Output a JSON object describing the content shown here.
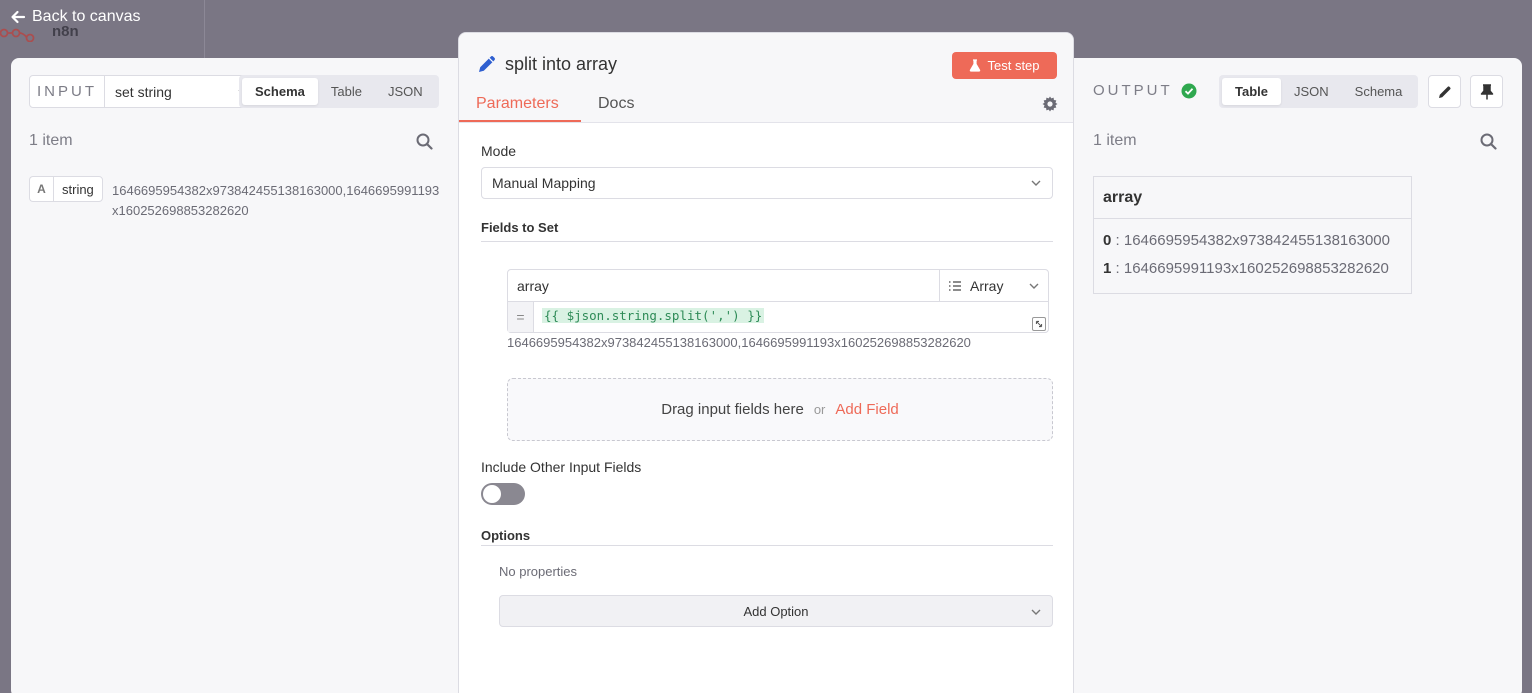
{
  "topbar": {
    "back_label": "Back to canvas",
    "logo_text": "n8n"
  },
  "input": {
    "label": "INPUT",
    "source_node": "set string",
    "view_tabs": [
      "Schema",
      "Table",
      "JSON"
    ],
    "active_tab": "Schema",
    "items_count": "1 item",
    "schema": {
      "type_badge": "A",
      "field": "string",
      "value": "1646695954382x973842455138163000,1646695991193x160252698853282620"
    }
  },
  "node": {
    "title": "split into array",
    "test_button": "Test step",
    "tabs": [
      "Parameters",
      "Docs"
    ],
    "active_tab": "Parameters",
    "mode_label": "Mode",
    "mode_value": "Manual Mapping",
    "fields_to_set_label": "Fields to Set",
    "assignment": {
      "name": "array",
      "type": "Array",
      "equals": "=",
      "expression": "{{ $json.string.split(',') }}",
      "preview": "1646695954382x973842455138163000,1646695991193x160252698853282620"
    },
    "drop_zone": {
      "text": "Drag input fields here",
      "or": "or",
      "add_field": "Add Field"
    },
    "include_other_label": "Include Other Input Fields",
    "include_other_enabled": false,
    "options_label": "Options",
    "no_properties": "No properties",
    "add_option": "Add Option"
  },
  "output": {
    "label": "OUTPUT",
    "status": "success",
    "view_tabs": [
      "Table",
      "JSON",
      "Schema"
    ],
    "active_tab": "Table",
    "items_count": "1 item",
    "table": {
      "header": "array",
      "rows": [
        {
          "index": "0",
          "value": "1646695954382x973842455138163000"
        },
        {
          "index": "1",
          "value": "1646695991193x160252698853282620"
        }
      ]
    }
  },
  "colors": {
    "accent": "#ee6a58",
    "success": "#2fa84f",
    "canvas_bg": "#7a7684",
    "panel_bg": "#f7f7f9",
    "pencil_blue": "#2f5fd0"
  }
}
